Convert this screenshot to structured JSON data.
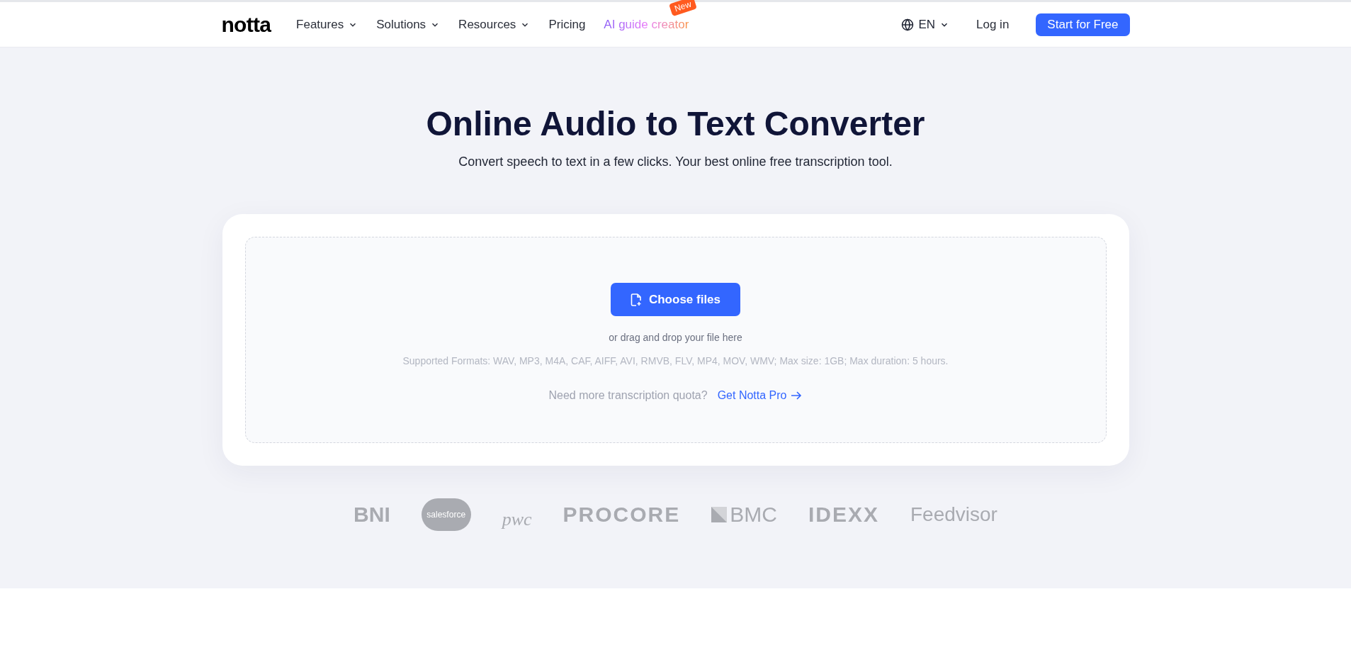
{
  "header": {
    "logo": "notta",
    "nav": [
      {
        "label": "Features",
        "kind": "dropdown"
      },
      {
        "label": "Solutions",
        "kind": "dropdown"
      },
      {
        "label": "Resources",
        "kind": "dropdown"
      },
      {
        "label": "Pricing",
        "kind": "link"
      },
      {
        "label": "AI guide creator",
        "kind": "highlight",
        "badge": "New"
      }
    ],
    "language": "EN",
    "login": "Log in",
    "cta": "Start for Free"
  },
  "hero": {
    "title": "Online Audio to Text Converter",
    "subtitle": "Convert speech to text in a few clicks. Your best online free transcription tool."
  },
  "upload": {
    "button": "Choose files",
    "drag_hint": "or drag and drop your file here",
    "formats": "Supported Formats: WAV, MP3, M4A, CAF, AIFF, AVI, RMVB, FLV, MP4, MOV, WMV; Max size: 1GB; Max duration: 5 hours.",
    "quota_text": "Need more transcription quota?",
    "quota_link": "Get Notta Pro"
  },
  "logos": [
    {
      "text": "BNI",
      "kind": "bold"
    },
    {
      "text": "salesforce",
      "kind": "cloud"
    },
    {
      "text": "pwc",
      "kind": "serif"
    },
    {
      "text": "PROCORE",
      "kind": "wide"
    },
    {
      "text": "BMC",
      "kind": "square"
    },
    {
      "text": "IDEXX",
      "kind": "wide"
    },
    {
      "text": "Feedvisor",
      "kind": "plain"
    }
  ]
}
